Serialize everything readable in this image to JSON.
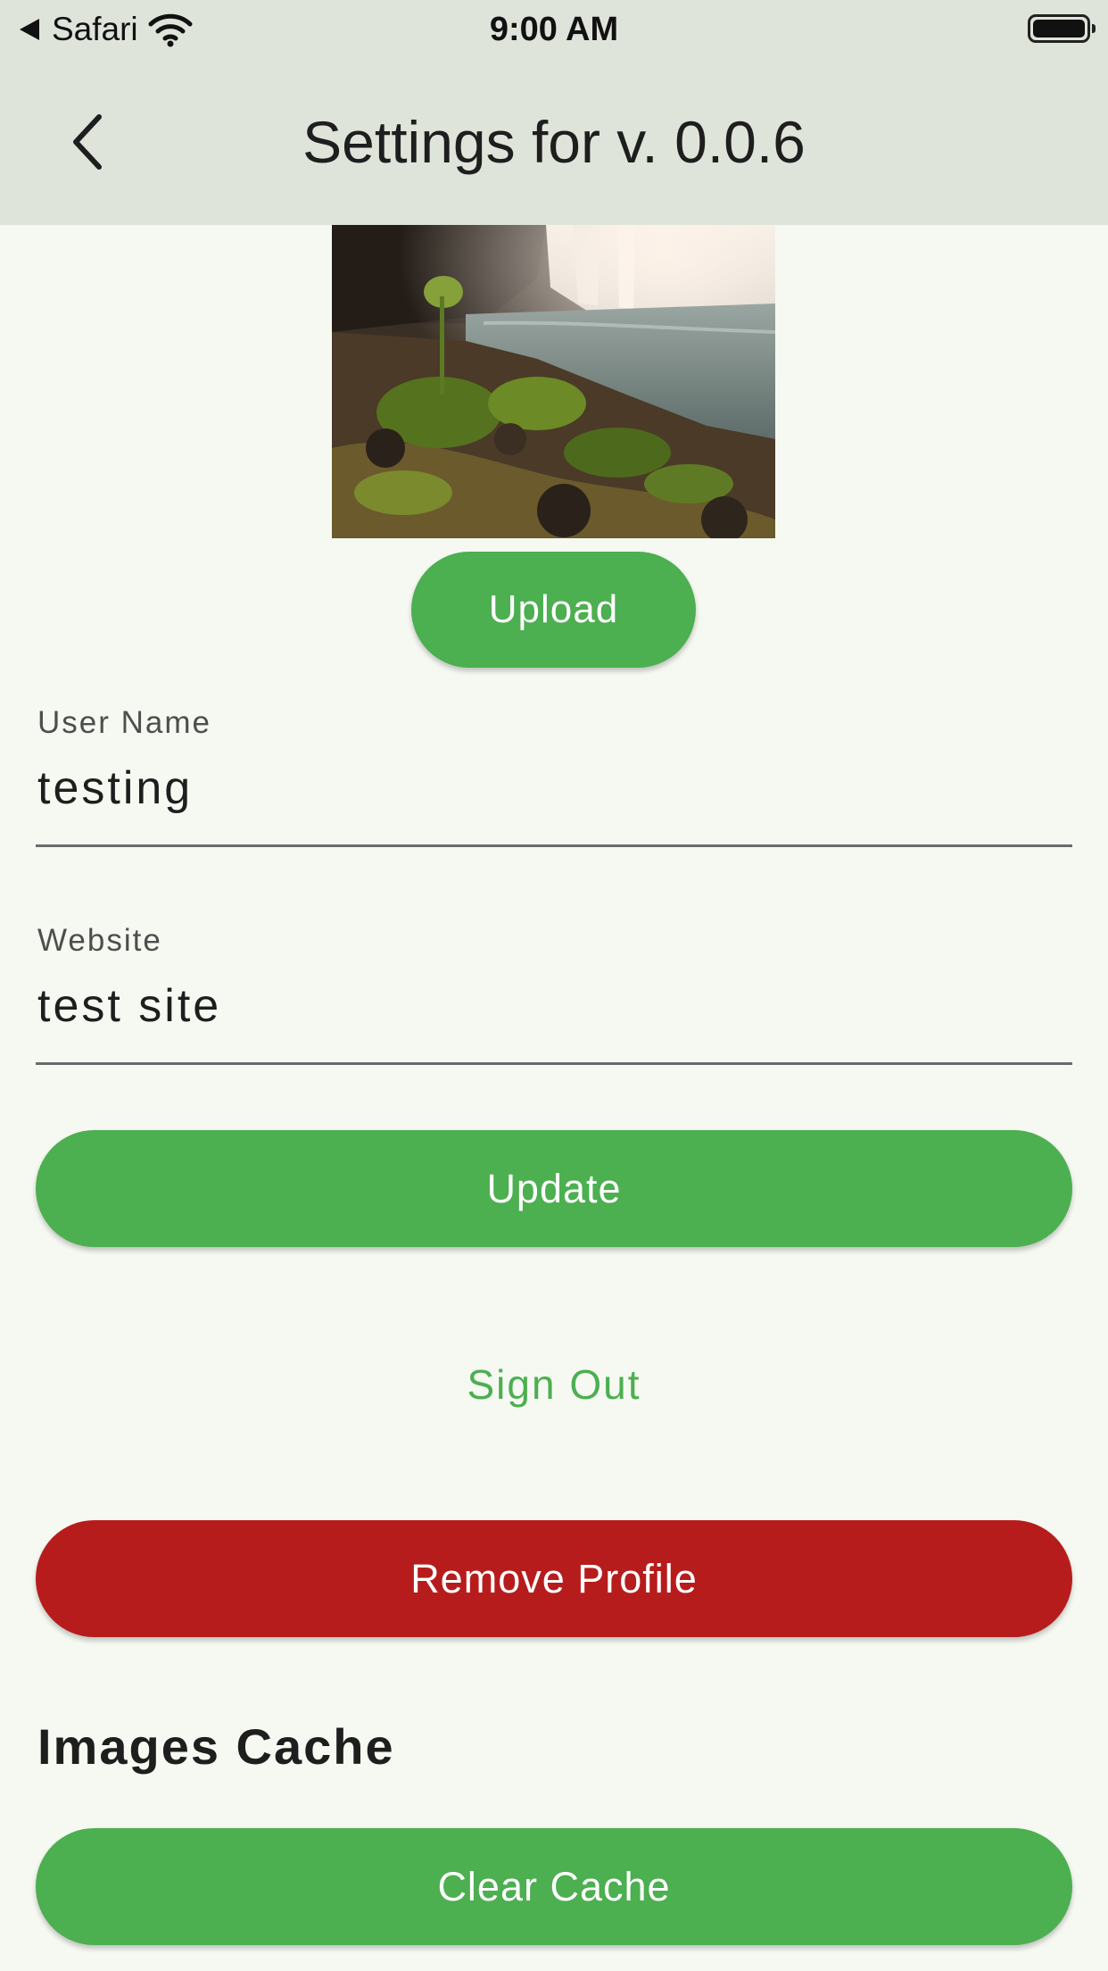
{
  "colors": {
    "background": "#f6f9f2",
    "app_bar": "#dfe4db",
    "primary_green": "#4caf50",
    "danger_red": "#b71c1c",
    "link_green": "#4caf50"
  },
  "status_bar": {
    "carrier": "Safari",
    "time": "9:00 AM",
    "icons": [
      "back-triangle-icon",
      "wifi-icon",
      "battery-icon"
    ]
  },
  "app_bar": {
    "title": "Settings for v. 0.0.6",
    "back_icon": "chevron-left-icon"
  },
  "profile": {
    "upload_label": "Upload"
  },
  "form": {
    "username": {
      "label": "User Name",
      "value": "testing"
    },
    "website": {
      "label": "Website",
      "value": "test site"
    },
    "update_label": "Update"
  },
  "actions": {
    "sign_out_label": "Sign Out",
    "remove_profile_label": "Remove Profile"
  },
  "cache": {
    "heading": "Images Cache",
    "clear_label": "Clear Cache"
  }
}
